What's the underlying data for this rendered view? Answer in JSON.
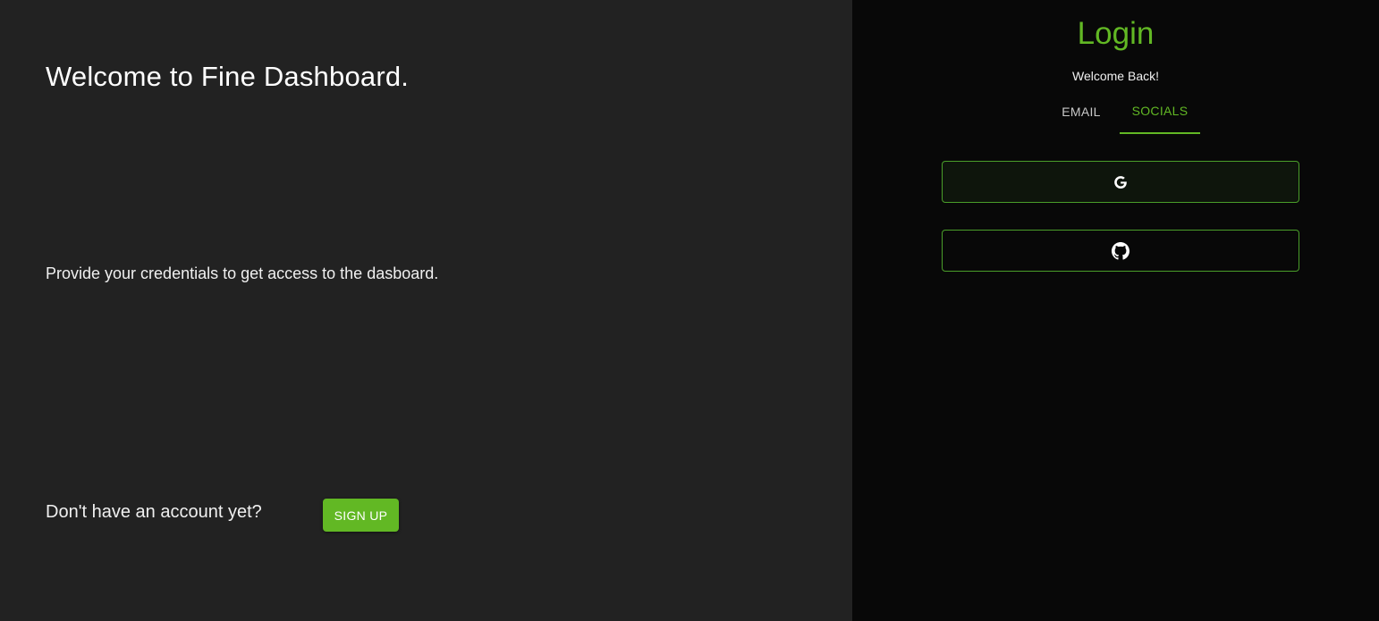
{
  "left": {
    "heading": "Welcome to Fine Dashboard.",
    "subtext": "Provide your credentials to get access to the dasboard.",
    "no_account": "Don't have an account yet?",
    "signup_label": "SIGN UP"
  },
  "right": {
    "title": "Login",
    "welcome_back": "Welcome Back!",
    "tabs": [
      {
        "label": "EMAIL",
        "active": false
      },
      {
        "label": "SOCIALS",
        "active": true
      }
    ],
    "social_buttons": [
      {
        "icon": "google-icon"
      },
      {
        "icon": "github-icon"
      }
    ]
  },
  "colors": {
    "accent": "#62b824",
    "left_bg": "#222222",
    "right_bg": "#080808"
  }
}
